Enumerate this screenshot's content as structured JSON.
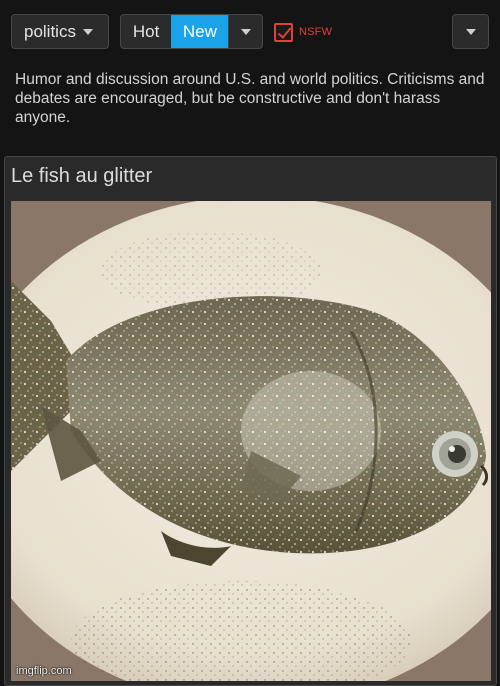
{
  "header": {
    "community": "politics",
    "sort_tabs": [
      {
        "label": "Hot",
        "active": false
      },
      {
        "label": "New",
        "active": true
      }
    ],
    "nsfw": {
      "label": "NSFW",
      "checked": true
    }
  },
  "description": "Humor and discussion around U.S. and world politics. Criticisms and debates are encouraged, but be constructive and don't harass anyone.",
  "post": {
    "title": "Le fish au glitter",
    "image_subject": "glitter-covered fish on a plate",
    "watermark": "imgflip.com"
  },
  "colors": {
    "background": "#141414",
    "panel": "#2a2a2a",
    "active_tab": "#1aa3e8",
    "nsfw": "#e2403a"
  }
}
